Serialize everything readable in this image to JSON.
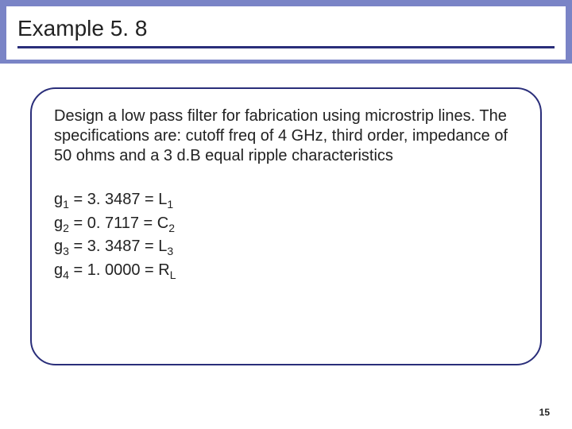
{
  "title": "Example 5. 8",
  "description": "Design a low pass filter for fabrication using microstrip lines. The specifications are: cutoff freq of 4 GHz, third order, impedance of 50 ohms and a 3 d.B equal ripple characteristics",
  "equations": [
    {
      "lhs_sym": "g",
      "lhs_sub": "1",
      "val": "3. 3487",
      "rhs_sym": "L",
      "rhs_sub": "1"
    },
    {
      "lhs_sym": "g",
      "lhs_sub": "2",
      "val": "0. 7117",
      "rhs_sym": "C",
      "rhs_sub": "2"
    },
    {
      "lhs_sym": "g",
      "lhs_sub": "3",
      "val": "3. 3487",
      "rhs_sym": "L",
      "rhs_sub": "3"
    },
    {
      "lhs_sym": "g",
      "lhs_sub": "4",
      "val": "1. 0000",
      "rhs_sym": "R",
      "rhs_sub": "L"
    }
  ],
  "page_number": "15"
}
